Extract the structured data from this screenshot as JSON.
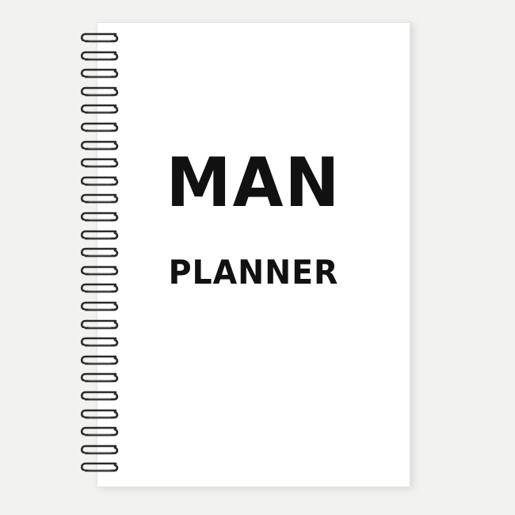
{
  "notebook": {
    "title": "MAN",
    "subtitle": "PLANNER",
    "spiral_coil_count": 25
  },
  "colors": {
    "background": "#f2f2f0",
    "cover": "#ffffff",
    "text": "#111111",
    "coil_dark": "#2b2b2b",
    "coil_light": "#8a8a8a"
  }
}
